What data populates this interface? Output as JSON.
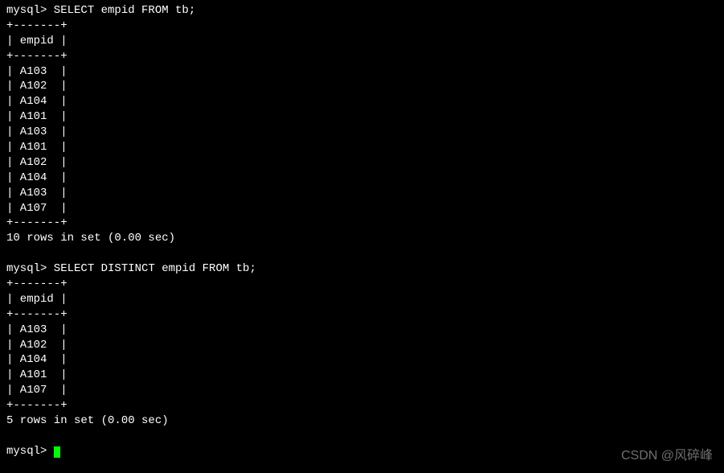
{
  "prompt_prefix": "mysql> ",
  "queries": [
    {
      "sql": "SELECT empid FROM tb;",
      "border": "+-------+",
      "header_row": "| empid |",
      "rows": [
        "| A103  |",
        "| A102  |",
        "| A104  |",
        "| A101  |",
        "| A103  |",
        "| A101  |",
        "| A102  |",
        "| A104  |",
        "| A103  |",
        "| A107  |"
      ],
      "result_status": "10 rows in set (0.00 sec)"
    },
    {
      "sql": "SELECT DISTINCT empid FROM tb;",
      "border": "+-------+",
      "header_row": "| empid |",
      "rows": [
        "| A103  |",
        "| A102  |",
        "| A104  |",
        "| A101  |",
        "| A107  |"
      ],
      "result_status": "5 rows in set (0.00 sec)"
    }
  ],
  "final_prompt": "mysql> ",
  "watermark": "CSDN @风碎峰"
}
